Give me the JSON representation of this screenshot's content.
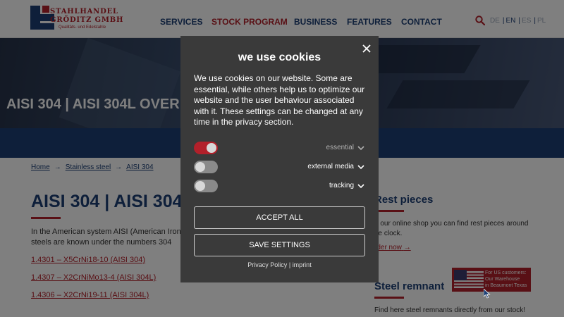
{
  "header": {
    "logo": {
      "line1": "STAHLHANDEL",
      "line2": "GRÖDITZ GMBH",
      "tagline": "Qualitäts- und Edelstahle"
    },
    "nav": [
      {
        "label": "SERVICES"
      },
      {
        "label": "STOCK PROGRAM"
      },
      {
        "label": "BUSINESS"
      },
      {
        "label": "FEATURES"
      },
      {
        "label": "CONTACT"
      }
    ],
    "languages": [
      "DE",
      "EN",
      "ES",
      "PL"
    ],
    "current_language": "EN",
    "search_icon": "search-icon"
  },
  "hero": {
    "title": "AISI 304 | AISI 304L OVER"
  },
  "breadcrumb": [
    "Home",
    "Stainless steel",
    "AISI 304"
  ],
  "main": {
    "title": "AISI 304 | AISI 304",
    "intro": "In the American system AISI (American Iron steels are known under the numbers 304",
    "links": [
      "1.4301 – X5CrNi18-10 (AISI 304)",
      "1.4307 – X2CrNiMo13-4 (AISI 304L)",
      "1.4306 – X2CrNi19-11 (AISI 304L)"
    ]
  },
  "sidebar": {
    "rest": {
      "title": "Rest pieces",
      "text": "n our online shop you can find rest pieces around he clock.",
      "link": "rder now"
    },
    "remnant": {
      "title": "Steel remnant",
      "text": "Find here steel remnants directly from our stock!"
    }
  },
  "us_badge": {
    "line1": "For US customers:",
    "line2": "Our Warehouse",
    "line3": "in Beaumont Texas"
  },
  "cookie_modal": {
    "title": "we use cookies",
    "text": "We use cookies on our website. Some are essential, while others help us to optimize our website and the user behaviour associated with it. These settings can be changed at any time in the privacy section.",
    "toggles": [
      {
        "label": "essential",
        "on": true
      },
      {
        "label": "external media",
        "on": false
      },
      {
        "label": "tracking",
        "on": false
      }
    ],
    "accept_label": "ACCEPT ALL",
    "save_label": "SAVE SETTINGS",
    "privacy_label": "Privacy Policy",
    "footer_separator": "|",
    "imprint_label": "imprint"
  },
  "colors": {
    "brand_blue": "#1c3f75",
    "brand_red": "#b2202a",
    "modal_bg": "#3a3a3a"
  }
}
